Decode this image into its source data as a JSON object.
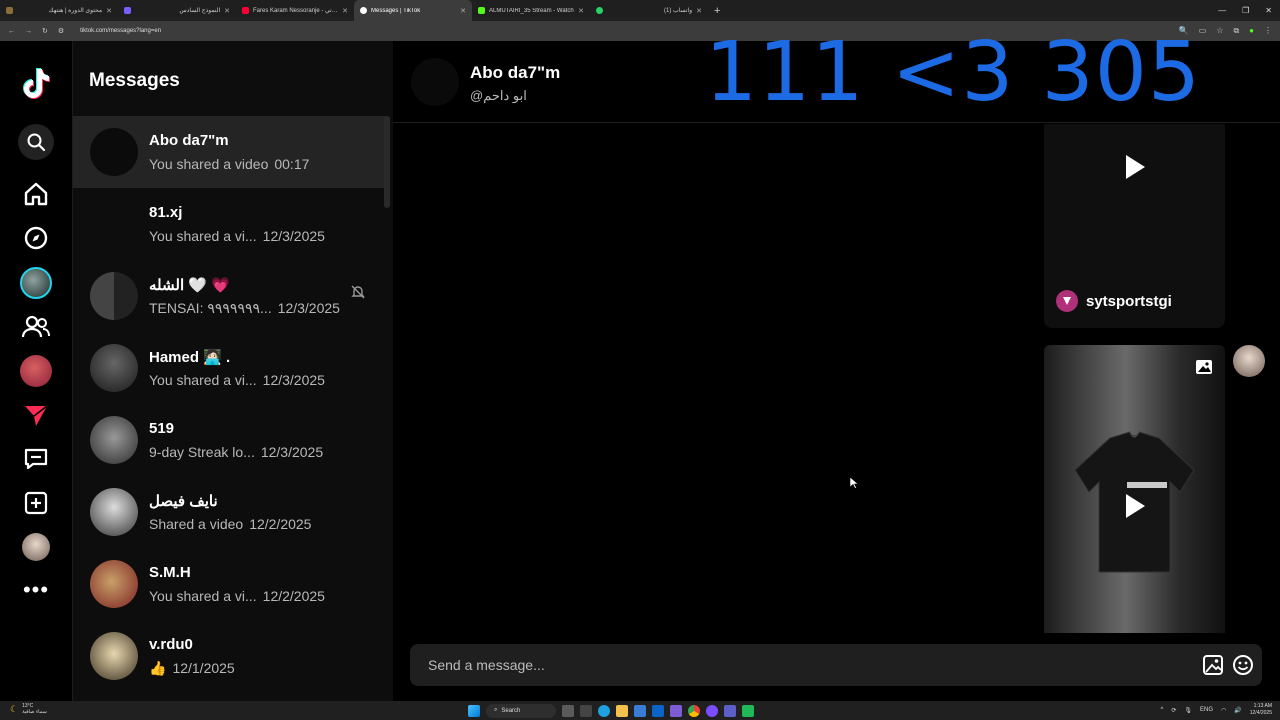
{
  "browser": {
    "tabs": [
      {
        "label": "محتوى الدورة | هنتهك",
        "color": "#8a6d3b",
        "active": false
      },
      {
        "label": "النموذج السادس",
        "color": "#7b5cff",
        "active": false
      },
      {
        "label": "Fares Karam Nessoranje - بنوتي",
        "color": "#ff0033",
        "active": false
      },
      {
        "label": "Messages | TikTok",
        "color": "#ffffff",
        "active": true
      },
      {
        "label": "ALMUTAIRI_35 Stream - Watch",
        "color": "#53fc18",
        "active": false
      },
      {
        "label": "(1) واتساب",
        "color": "#25d366",
        "active": false
      }
    ],
    "new_tab": "+",
    "url": "tiktok.com/messages?lang=en"
  },
  "sidebar_title": "Messages",
  "overlay_text": "111 <3 305",
  "conversations": [
    {
      "name": "Abo da7\"m",
      "preview": "You shared a video",
      "time": "00:17",
      "active": true
    },
    {
      "name": "81.xj",
      "preview": "You shared a vi...",
      "time": "12/3/2025",
      "active": false
    },
    {
      "name": "الشله 🤍 💗",
      "preview": "TENSAI: ٩٩٩٩٩٩٩...",
      "time": "12/3/2025",
      "active": false,
      "muted": true
    },
    {
      "name": "Hamed 🧑🏻‍💻 .",
      "preview": "You shared a vi...",
      "time": "12/3/2025",
      "active": false
    },
    {
      "name": "519",
      "preview": "9-day Streak lo...",
      "time": "12/3/2025",
      "active": false
    },
    {
      "name": "نايف فيصل",
      "preview": "Shared a video",
      "time": "12/2/2025",
      "active": false
    },
    {
      "name": "S.M.H",
      "preview": "You shared a vi...",
      "time": "12/2/2025",
      "active": false
    },
    {
      "name": "v.rdu0",
      "preview": "👍",
      "time": "12/1/2025",
      "active": false
    }
  ],
  "chat": {
    "name": "Abo da7\"m",
    "handle": "@ابو داحم",
    "shared_card_user": "sytsportstgi",
    "composer_placeholder": "Send a message..."
  },
  "taskbar": {
    "weather_temp": "13°C",
    "weather_desc": "سماء صافية",
    "search_label": "Search",
    "lang": "ENG",
    "time": "1:13 AM",
    "date": "12/4/2025"
  }
}
